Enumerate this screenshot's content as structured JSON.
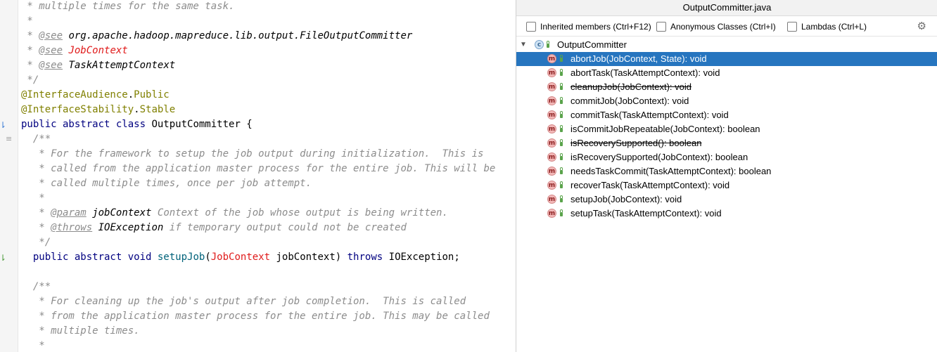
{
  "editor": {
    "lines": [
      [
        [
          "cm",
          " * multiple times for the same task."
        ]
      ],
      [
        [
          "cm",
          " *"
        ]
      ],
      [
        [
          "cm",
          " * "
        ],
        [
          "tag",
          "@see"
        ],
        [
          "cm",
          " "
        ],
        [
          "ref",
          "org.apache.hadoop.mapreduce.lib.output.FileOutputCommitter"
        ]
      ],
      [
        [
          "cm",
          " * "
        ],
        [
          "tag",
          "@see"
        ],
        [
          "cm",
          " "
        ],
        [
          "refred",
          "JobContext"
        ]
      ],
      [
        [
          "cm",
          " * "
        ],
        [
          "tag",
          "@see"
        ],
        [
          "cm",
          " "
        ],
        [
          "ref",
          "TaskAttemptContext"
        ]
      ],
      [
        [
          "cm",
          " */"
        ]
      ],
      [
        [
          "ann",
          "@InterfaceAudience"
        ],
        [
          "",
          "."
        ],
        [
          "ann",
          "Public"
        ]
      ],
      [
        [
          "ann",
          "@InterfaceStability"
        ],
        [
          "",
          "."
        ],
        [
          "ann",
          "Stable"
        ]
      ],
      [
        [
          "kw",
          "public abstract class "
        ],
        [
          "",
          "OutputCommitter {"
        ]
      ],
      [
        [
          "cm",
          "  /**"
        ]
      ],
      [
        [
          "cm",
          "   * For the framework to setup the job output during initialization.  This is"
        ]
      ],
      [
        [
          "cm",
          "   * called from the application master process for the entire job. This will be"
        ]
      ],
      [
        [
          "cm",
          "   * called multiple times, once per job attempt."
        ]
      ],
      [
        [
          "cm",
          "   *"
        ]
      ],
      [
        [
          "cm",
          "   * "
        ],
        [
          "tag",
          "@param"
        ],
        [
          "cm",
          " "
        ],
        [
          "ref",
          "jobContext"
        ],
        [
          "cm",
          " Context of the job whose output is being written."
        ]
      ],
      [
        [
          "cm",
          "   * "
        ],
        [
          "tag",
          "@throws"
        ],
        [
          "cm",
          " "
        ],
        [
          "ref",
          "IOException"
        ],
        [
          "cm",
          " if temporary output could not be created"
        ]
      ],
      [
        [
          "cm",
          "   */"
        ]
      ],
      [
        [
          "kw",
          "  public abstract void "
        ],
        [
          "fn",
          "setupJob"
        ],
        [
          "",
          "("
        ],
        [
          "ty",
          "JobContext"
        ],
        [
          "",
          " jobContext) "
        ],
        [
          "kw",
          "throws "
        ],
        [
          "",
          "IOException;"
        ]
      ],
      [
        [
          "",
          ""
        ]
      ],
      [
        [
          "cm",
          "  /**"
        ]
      ],
      [
        [
          "cm",
          "   * For cleaning up the job's output after job completion.  This is called"
        ]
      ],
      [
        [
          "cm",
          "   * from the application master process for the entire job. This may be called"
        ]
      ],
      [
        [
          "cm",
          "   * multiple times."
        ]
      ],
      [
        [
          "cm",
          "   *"
        ]
      ]
    ]
  },
  "structure": {
    "title": "OutputCommitter.java",
    "options": [
      {
        "label": "Inherited members (Ctrl+F12)",
        "checked": false
      },
      {
        "label": "Anonymous Classes (Ctrl+I)",
        "checked": false
      },
      {
        "label": "Lambdas (Ctrl+L)",
        "checked": false
      }
    ],
    "settings_icon": "gear-icon",
    "class_icon_letter": "c",
    "method_icon_letter": "m",
    "root": "OutputCommitter",
    "members": [
      {
        "label": "abortJob(JobContext, State): void",
        "selected": true,
        "deprecated": false
      },
      {
        "label": "abortTask(TaskAttemptContext): void",
        "selected": false,
        "deprecated": false
      },
      {
        "label": "cleanupJob(JobContext): void",
        "selected": false,
        "deprecated": true
      },
      {
        "label": "commitJob(JobContext): void",
        "selected": false,
        "deprecated": false
      },
      {
        "label": "commitTask(TaskAttemptContext): void",
        "selected": false,
        "deprecated": false
      },
      {
        "label": "isCommitJobRepeatable(JobContext): boolean",
        "selected": false,
        "deprecated": false
      },
      {
        "label": "isRecoverySupported(): boolean",
        "selected": false,
        "deprecated": true
      },
      {
        "label": "isRecoverySupported(JobContext): boolean",
        "selected": false,
        "deprecated": false
      },
      {
        "label": "needsTaskCommit(TaskAttemptContext): boolean",
        "selected": false,
        "deprecated": false
      },
      {
        "label": "recoverTask(TaskAttemptContext): void",
        "selected": false,
        "deprecated": false
      },
      {
        "label": "setupJob(JobContext): void",
        "selected": false,
        "deprecated": false
      },
      {
        "label": "setupTask(TaskAttemptContext): void",
        "selected": false,
        "deprecated": false
      }
    ]
  },
  "colors": {
    "selection": "#2675bf",
    "keyword": "#000080",
    "annotation": "#808000",
    "comment": "#8c8c8c",
    "error_ref": "#e01b1b"
  }
}
